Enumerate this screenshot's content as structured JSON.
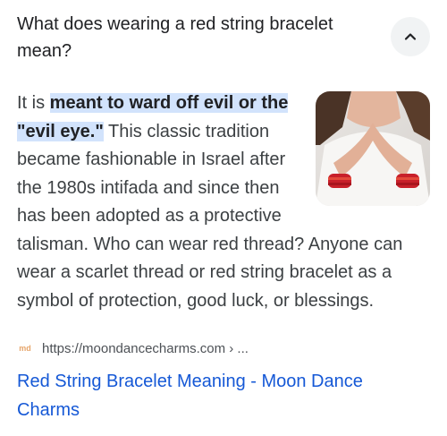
{
  "question": "What does wearing a red string bracelet mean?",
  "answer": {
    "prefix": "It is ",
    "highlight": "meant to ward off evil or the \"evil eye.\"",
    "suffix": " This classic tradition became fashionable in Israel after the 1980s intifada and since then has been adopted as a protective talisman. Who can wear red thread? Anyone can wear a scarlet thread or red string bracelet as a symbol of protection, good luck, or blessings."
  },
  "source": {
    "favicon_text": "md",
    "url": "https://moondancecharms.com › ..."
  },
  "result_title": "Red String Bracelet Meaning - Moon Dance Charms",
  "icons": {
    "collapse": "chevron-up-icon",
    "thumbnail": "hands-red-bracelet-image"
  },
  "colors": {
    "highlight": "#d2e3fc",
    "link": "#1558d6",
    "button_bg": "#f1f3f4"
  }
}
